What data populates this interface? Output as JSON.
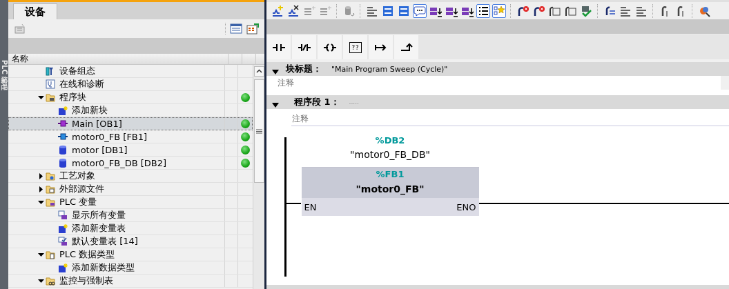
{
  "side_strip": {
    "label": "PLC 编程"
  },
  "project_tree": {
    "tab": {
      "label": "设备",
      "selected": true
    },
    "columns": [
      {
        "label": "名称"
      }
    ],
    "items": [
      {
        "label": "设备组态",
        "kind": "device",
        "online": false,
        "selected": false
      },
      {
        "label": "在线和诊断",
        "kind": "diagnostics",
        "online": false,
        "selected": false
      },
      {
        "label": "程序块",
        "kind": "folder-block",
        "expanded": true,
        "online": true,
        "selected": false,
        "children": [
          {
            "label": "添加新块",
            "kind": "add",
            "online": false,
            "selected": false
          },
          {
            "label": "Main [OB1]",
            "kind": "ob",
            "online": true,
            "selected": true
          },
          {
            "label": "motor0_FB [FB1]",
            "kind": "fb",
            "online": true,
            "selected": false
          },
          {
            "label": "motor [DB1]",
            "kind": "db",
            "online": true,
            "selected": false
          },
          {
            "label": "motor0_FB_DB [DB2]",
            "kind": "db",
            "online": true,
            "selected": false
          }
        ]
      },
      {
        "label": "工艺对象",
        "kind": "folder-tech",
        "expanded": false,
        "online": false,
        "selected": false
      },
      {
        "label": "外部源文件",
        "kind": "folder-source",
        "expanded": false,
        "online": false,
        "selected": false
      },
      {
        "label": "PLC 变量",
        "kind": "folder-tag",
        "expanded": true,
        "online": false,
        "selected": false,
        "children": [
          {
            "label": "显示所有变量",
            "kind": "tags",
            "online": false,
            "selected": false
          },
          {
            "label": "添加新变量表",
            "kind": "add",
            "online": false,
            "selected": false
          },
          {
            "label": "默认变量表 [14]",
            "kind": "tag-table",
            "online": false,
            "selected": false
          }
        ]
      },
      {
        "label": "PLC 数据类型",
        "kind": "folder-type",
        "expanded": true,
        "online": false,
        "selected": false,
        "children": [
          {
            "label": "添加新数据类型",
            "kind": "add",
            "online": false,
            "selected": false
          }
        ]
      },
      {
        "label": "监控与强制表",
        "kind": "folder-watch",
        "expanded": true,
        "online": false,
        "selected": false
      }
    ]
  },
  "editor": {
    "toolbar": [
      {
        "kind": "network-add",
        "pressed": false
      },
      {
        "kind": "network-delete",
        "pressed": false
      },
      {
        "kind": "row-insert",
        "pressed": false
      },
      {
        "kind": "row-append",
        "pressed": false
      },
      {
        "kind": "sep"
      },
      {
        "kind": "db-undo",
        "pressed": false
      },
      {
        "kind": "sep"
      },
      {
        "kind": "lines",
        "pressed": false
      },
      {
        "kind": "panel",
        "pressed": false
      },
      {
        "kind": "panel",
        "pressed": false
      },
      {
        "kind": "comment",
        "pressed": true
      },
      {
        "kind": "tag-load",
        "pressed": false
      },
      {
        "kind": "tag-load",
        "pressed": false
      },
      {
        "kind": "tag-load",
        "pressed": false
      },
      {
        "kind": "list",
        "pressed": true
      },
      {
        "kind": "favorites",
        "pressed": true
      },
      {
        "kind": "sep"
      },
      {
        "kind": "jump-error",
        "pressed": false
      },
      {
        "kind": "jump-error",
        "pressed": false
      },
      {
        "kind": "block-go",
        "pressed": false
      },
      {
        "kind": "block-go",
        "pressed": false
      },
      {
        "kind": "check",
        "pressed": false
      },
      {
        "kind": "sep"
      },
      {
        "kind": "go-lines",
        "pressed": false
      },
      {
        "kind": "lines",
        "pressed": false
      },
      {
        "kind": "lines",
        "pressed": false
      },
      {
        "kind": "sep"
      },
      {
        "kind": "step",
        "pressed": false
      },
      {
        "kind": "step",
        "pressed": false
      },
      {
        "kind": "sep"
      },
      {
        "kind": "search",
        "pressed": false
      }
    ],
    "instructions": [
      {
        "kind": "no-contact"
      },
      {
        "kind": "nc-contact"
      },
      {
        "kind": "coil"
      },
      {
        "kind": "empty-box",
        "label": "??"
      },
      {
        "kind": "open-branch"
      },
      {
        "kind": "close-branch"
      }
    ],
    "block_title": {
      "label": "块标题：",
      "value": "\"Main Program Sweep (Cycle)\"",
      "expanded": true,
      "comment": "注释"
    },
    "network": {
      "label": "程序段 1：",
      "title": ".....",
      "expanded": true,
      "comment": "注释",
      "call": {
        "instance_address": "%DB2",
        "instance_name": "\"motor0_FB_DB\"",
        "address": "%FB1",
        "name": "\"motor0_FB\"",
        "input": "EN",
        "output": "ENO"
      }
    }
  }
}
